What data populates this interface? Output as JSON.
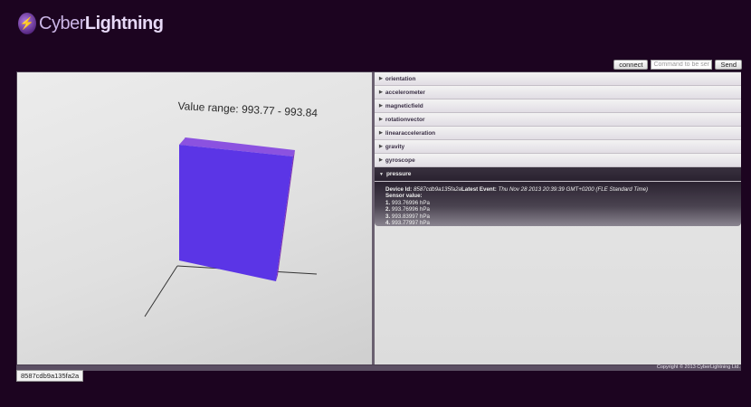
{
  "brand": {
    "name_prefix": "Cyber",
    "name_suffix": "Lightning",
    "logo_icon": "lightning-bolt-icon"
  },
  "toolbar": {
    "connect_label": "connect",
    "command_placeholder": "Command to be sent to",
    "send_label": "Send"
  },
  "viewer": {
    "range_text": "Value range: 993.77 - 993.84",
    "bar_color": "#5b35e6",
    "bar_side_color": "#7b2fb0",
    "bar_top_color": "#8b52e0"
  },
  "accordion": {
    "items": [
      {
        "label": "orientation"
      },
      {
        "label": "accelerometer"
      },
      {
        "label": "magneticfield"
      },
      {
        "label": "rotationvector"
      },
      {
        "label": "linearacceleration"
      },
      {
        "label": "gravity"
      },
      {
        "label": "gyroscope"
      },
      {
        "label": "pressure"
      }
    ],
    "active": {
      "device_id_label": "Device Id:",
      "device_id": "8587cdb9a135fa2a",
      "latest_event_label": "Latest Event:",
      "latest_event": "Thu Nov 28 2013 20:39:39 GMT+0200 (FLE Standard Time)",
      "sensor_value_label": "Sensor value:",
      "values": [
        {
          "index": "1.",
          "text": "993.76996 hPa"
        },
        {
          "index": "2.",
          "text": "993.76996 hPa"
        },
        {
          "index": "3.",
          "text": "993.83997 hPa"
        },
        {
          "index": "4.",
          "text": "993.77997 hPa"
        }
      ]
    }
  },
  "footer": {
    "copyright": "Copyright © 2013 CyberLightning Ltd.",
    "device_tag": "8587cdb9a135fa2a"
  }
}
